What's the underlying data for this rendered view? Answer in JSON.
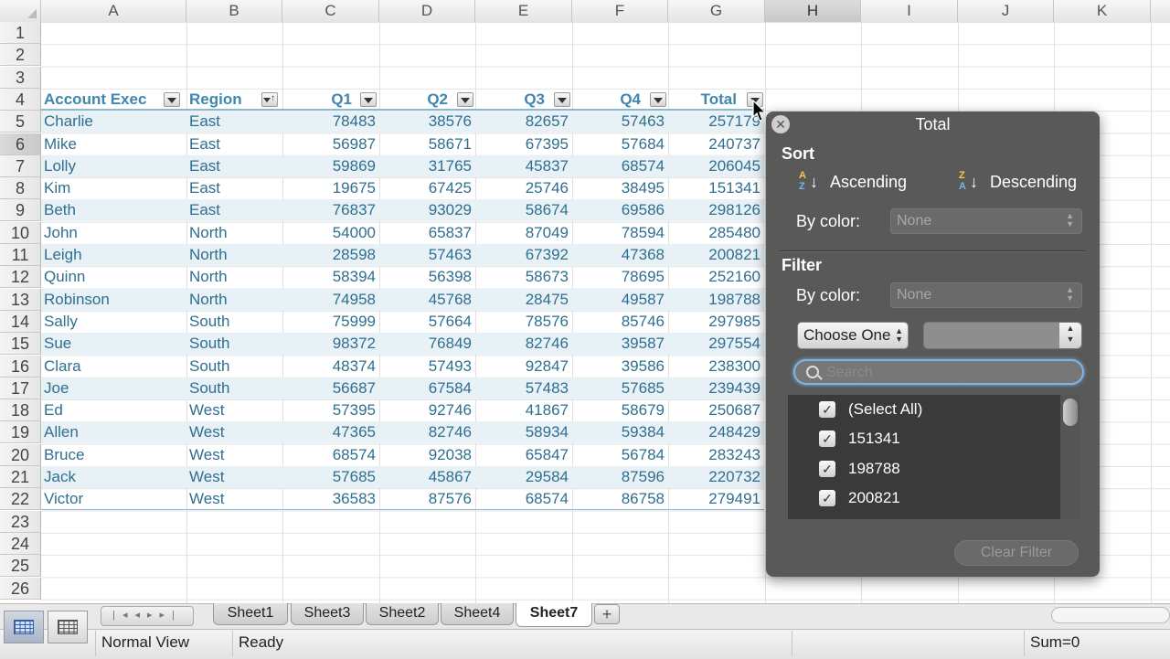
{
  "columns": [
    "A",
    "B",
    "C",
    "D",
    "E",
    "F",
    "G",
    "H",
    "I",
    "J",
    "K"
  ],
  "rows": [
    "1",
    "2",
    "3",
    "4",
    "5",
    "6",
    "7",
    "8",
    "9",
    "10",
    "11",
    "12",
    "13",
    "14",
    "15",
    "16",
    "17",
    "18",
    "19",
    "20",
    "21",
    "22",
    "23",
    "24",
    "25",
    "26"
  ],
  "selected_column": "H",
  "selected_row": "6",
  "table": {
    "headers": [
      "Account Exec",
      "Region",
      "Q1",
      "Q2",
      "Q3",
      "Q4",
      "Total"
    ],
    "data": [
      [
        "Charlie",
        "East",
        "78483",
        "38576",
        "82657",
        "57463",
        "257179"
      ],
      [
        "Mike",
        "East",
        "56987",
        "58671",
        "67395",
        "57684",
        "240737"
      ],
      [
        "Lolly",
        "East",
        "59869",
        "31765",
        "45837",
        "68574",
        "206045"
      ],
      [
        "Kim",
        "East",
        "19675",
        "67425",
        "25746",
        "38495",
        "151341"
      ],
      [
        "Beth",
        "East",
        "76837",
        "93029",
        "58674",
        "69586",
        "298126"
      ],
      [
        "John",
        "North",
        "54000",
        "65837",
        "87049",
        "78594",
        "285480"
      ],
      [
        "Leigh",
        "North",
        "28598",
        "57463",
        "67392",
        "47368",
        "200821"
      ],
      [
        "Quinn",
        "North",
        "58394",
        "56398",
        "58673",
        "78695",
        "252160"
      ],
      [
        "Robinson",
        "North",
        "74958",
        "45768",
        "28475",
        "49587",
        "198788"
      ],
      [
        "Sally",
        "South",
        "75999",
        "57664",
        "78576",
        "85746",
        "297985"
      ],
      [
        "Sue",
        "South",
        "98372",
        "76849",
        "82746",
        "39587",
        "297554"
      ],
      [
        "Clara",
        "South",
        "48374",
        "57493",
        "92847",
        "39586",
        "238300"
      ],
      [
        "Joe",
        "South",
        "56687",
        "67584",
        "57483",
        "57685",
        "239439"
      ],
      [
        "Ed",
        "West",
        "57395",
        "92746",
        "41867",
        "58679",
        "250687"
      ],
      [
        "Allen",
        "West",
        "47365",
        "82746",
        "58934",
        "59384",
        "248429"
      ],
      [
        "Bruce",
        "West",
        "68574",
        "92038",
        "65847",
        "56784",
        "283243"
      ],
      [
        "Jack",
        "West",
        "57685",
        "45867",
        "29584",
        "87596",
        "220732"
      ],
      [
        "Victor",
        "West",
        "36583",
        "87576",
        "68574",
        "86758",
        "279491"
      ]
    ]
  },
  "filter_popup": {
    "title": "Total",
    "sort_label": "Sort",
    "ascending": "Ascending",
    "descending": "Descending",
    "az_top": "A",
    "az_bottom": "Z",
    "za_top": "Z",
    "za_bottom": "A",
    "by_color_label": "By color:",
    "sort_color_value": "None",
    "filter_label": "Filter",
    "filter_color_value": "None",
    "choose_one": "Choose One",
    "search_placeholder": "Search",
    "items": [
      {
        "label": "(Select All)",
        "checked": true
      },
      {
        "label": "151341",
        "checked": true
      },
      {
        "label": "198788",
        "checked": true
      },
      {
        "label": "200821",
        "checked": true
      }
    ],
    "clear_filter": "Clear Filter"
  },
  "sheets": [
    "Sheet1",
    "Sheet3",
    "Sheet2",
    "Sheet4",
    "Sheet7"
  ],
  "active_sheet": "Sheet7",
  "add_sheet": "+",
  "status": {
    "view": "Normal View",
    "state": "Ready",
    "sum": "Sum=0"
  }
}
